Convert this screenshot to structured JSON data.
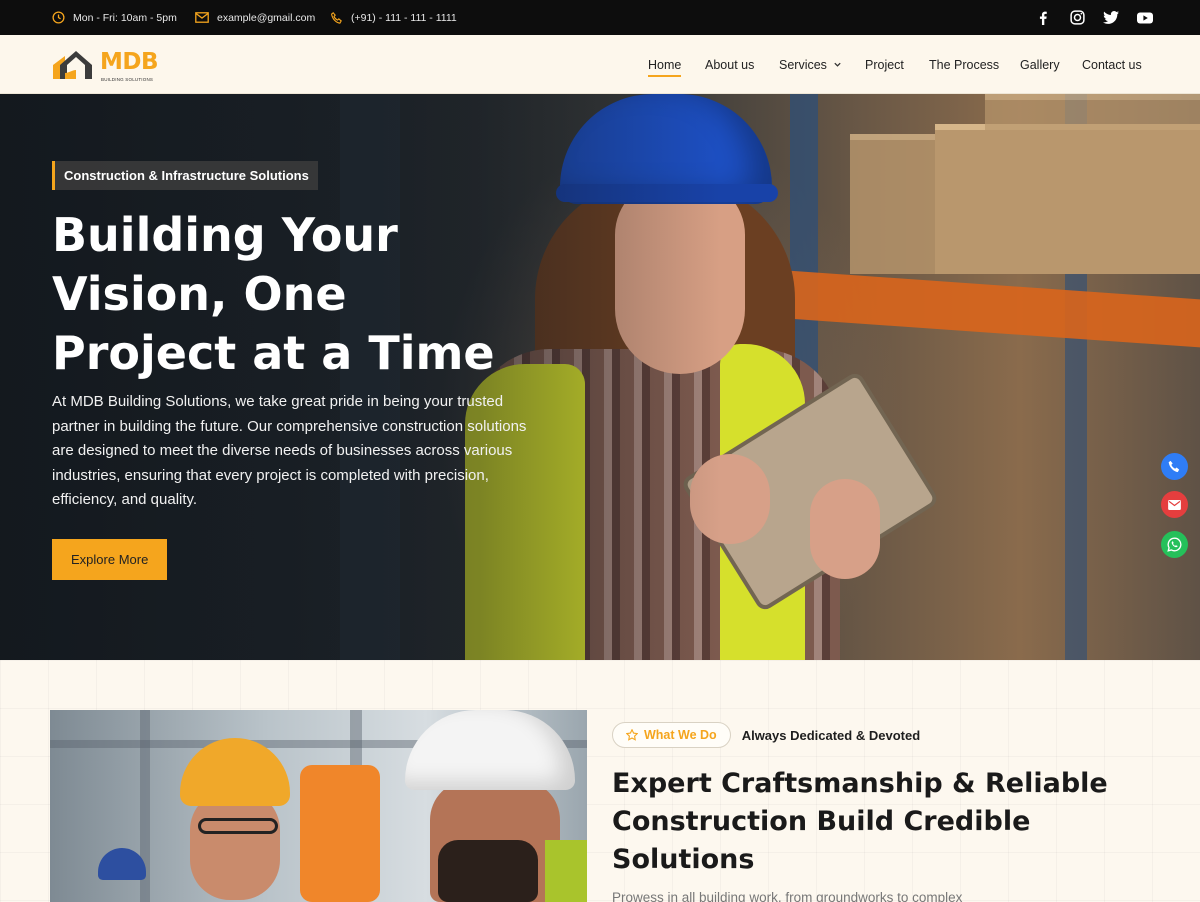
{
  "topbar": {
    "hours": "Mon - Fri: 10am - 5pm",
    "email": "example@gmail.com",
    "phone": "(+91) - 111 - 111 - 1111",
    "social": [
      "facebook-icon",
      "instagram-icon",
      "twitter-icon",
      "youtube-icon"
    ]
  },
  "logo": {
    "name": "MDB",
    "tagline": "BUILDING SOLUTIONS"
  },
  "nav": {
    "items": [
      {
        "label": "Home",
        "active": true
      },
      {
        "label": "About us"
      },
      {
        "label": "Services",
        "has_dropdown": true
      },
      {
        "label": "Project"
      },
      {
        "label": "The Process"
      },
      {
        "label": "Gallery"
      },
      {
        "label": "Contact us"
      }
    ]
  },
  "hero": {
    "tag": "Construction & Infrastructure Solutions",
    "title": "Building Your Vision, One Project at a Time",
    "text": "At MDB Building Solutions, we take great pride in being your trusted partner in building the future. Our comprehensive construction solutions are designed to meet the diverse needs of businesses across various industries, ensuring that every project is completed with precision, efficiency, and quality.",
    "button": "Explore More"
  },
  "floating": [
    "phone-icon",
    "mail-icon",
    "whatsapp-icon"
  ],
  "whatwedo": {
    "pill": "What We Do",
    "subtitle": "Always Dedicated & Devoted",
    "title": "Expert Craftsmanship & Reliable Construction Build Credible Solutions",
    "text": "Prowess in all building work, from groundworks to complex"
  },
  "colors": {
    "accent": "#f5a51d",
    "topbar": "#0d0d0d",
    "navbar": "#fdf7ec",
    "call": "#2f7df6",
    "mail": "#e53e3e",
    "whatsapp": "#25c05a"
  }
}
